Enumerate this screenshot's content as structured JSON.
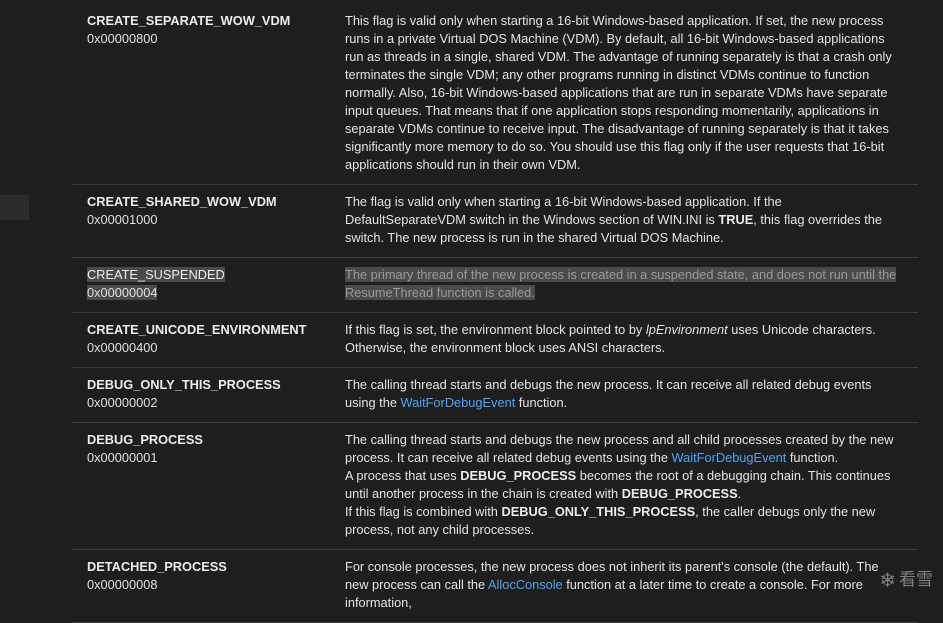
{
  "rows": [
    {
      "name": "CREATE_SEPARATE_WOW_VDM",
      "value": "0x00000800",
      "desc": [
        {
          "t": "This flag is valid only when starting a 16-bit Windows-based application. If set, the new process runs in a private Virtual DOS Machine (VDM). By default, all 16-bit Windows-based applications run as threads in a single, shared VDM. The advantage of running separately is that a crash only terminates the single VDM; any other programs running in distinct VDMs continue to function normally. Also, 16-bit Windows-based applications that are run in separate VDMs have separate input queues. That means that if one application stops responding momentarily, applications in separate VDMs continue to receive input. The disadvantage of running separately is that it takes significantly more memory to do so. You should use this flag only if the user requests that 16-bit applications should run in their own VDM."
        }
      ]
    },
    {
      "name": "CREATE_SHARED_WOW_VDM",
      "value": "0x00001000",
      "desc": [
        {
          "t": "The flag is valid only when starting a 16-bit Windows-based application. If the DefaultSeparateVDM switch in the Windows section of WIN.INI is "
        },
        {
          "t": "TRUE",
          "s": "b"
        },
        {
          "t": ", this flag overrides the switch. The new process is run in the shared Virtual DOS Machine."
        }
      ]
    },
    {
      "name": "CREATE_SUSPENDED",
      "value": "0x00000004",
      "selected": true,
      "desc": [
        {
          "t": "The primary thread of the new process is created in a suspended state, and does not run until the "
        },
        {
          "t": "ResumeThread",
          "s": "link"
        },
        {
          "t": " function is called."
        }
      ]
    },
    {
      "name": "CREATE_UNICODE_ENVIRONMENT",
      "value": "0x00000400",
      "desc": [
        {
          "t": "If this flag is set, the environment block pointed to by "
        },
        {
          "t": "lpEnvironment",
          "s": "i"
        },
        {
          "t": " uses Unicode characters. Otherwise, the environment block uses ANSI characters."
        }
      ]
    },
    {
      "name": "DEBUG_ONLY_THIS_PROCESS",
      "value": "0x00000002",
      "desc": [
        {
          "t": "The calling thread starts and debugs the new process. It can receive all related debug events using the "
        },
        {
          "t": "WaitForDebugEvent",
          "s": "link"
        },
        {
          "t": " function."
        }
      ]
    },
    {
      "name": "DEBUG_PROCESS",
      "value": "0x00000001",
      "paras": [
        [
          {
            "t": "The calling thread starts and debugs the new process and all child processes created by the new process. It can receive all related debug events using the "
          },
          {
            "t": "WaitForDebugEvent",
            "s": "link"
          },
          {
            "t": " function."
          }
        ],
        [
          {
            "t": "A process that uses "
          },
          {
            "t": "DEBUG_PROCESS",
            "s": "b"
          },
          {
            "t": " becomes the root of a debugging chain. This continues until another process in the chain is created with "
          },
          {
            "t": "DEBUG_PROCESS",
            "s": "b"
          },
          {
            "t": "."
          }
        ],
        [
          {
            "t": "If this flag is combined with "
          },
          {
            "t": "DEBUG_ONLY_THIS_PROCESS",
            "s": "b"
          },
          {
            "t": ", the caller debugs only the new process, not any child processes."
          }
        ]
      ]
    },
    {
      "name": "DETACHED_PROCESS",
      "value": "0x00000008",
      "desc": [
        {
          "t": "For console processes, the new process does not inherit its parent's console (the default). The new process can call the "
        },
        {
          "t": "AllocConsole",
          "s": "link"
        },
        {
          "t": " function at a later time to create a console. For more information,"
        }
      ]
    }
  ],
  "watermark": {
    "text": "看雪",
    "icon": "snowflake-icon"
  }
}
